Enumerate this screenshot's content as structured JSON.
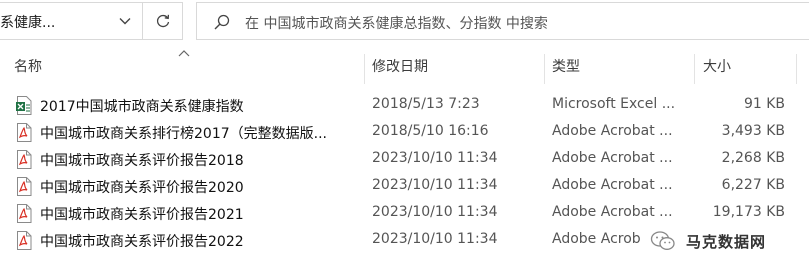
{
  "address_bar": {
    "path": "系健康...",
    "search_placeholder": "在 中国城市政商关系健康总指数、分指数 中搜索"
  },
  "columns": {
    "name": "名称",
    "date": "修改日期",
    "type": "类型",
    "size": "大小"
  },
  "files": [
    {
      "name": "2017中国城市政商关系健康指数",
      "date": "2018/5/13 7:23",
      "type": "Microsoft Excel ...",
      "size": "91 KB",
      "icon": "excel-icon"
    },
    {
      "name": "中国城市政商关系排行榜2017（完整数据版...",
      "date": "2018/5/10 16:16",
      "type": "Adobe Acrobat ...",
      "size": "3,493 KB",
      "icon": "pdf-icon"
    },
    {
      "name": "中国城市政商关系评价报告2018",
      "date": "2023/10/10 11:34",
      "type": "Adobe Acrobat ...",
      "size": "2,268 KB",
      "icon": "pdf-icon"
    },
    {
      "name": "中国城市政商关系评价报告2020",
      "date": "2023/10/10 11:34",
      "type": "Adobe Acrobat ...",
      "size": "6,227 KB",
      "icon": "pdf-icon"
    },
    {
      "name": "中国城市政商关系评价报告2021",
      "date": "2023/10/10 11:34",
      "type": "Adobe Acrobat ...",
      "size": "19,173 KB",
      "icon": "pdf-icon"
    },
    {
      "name": "中国城市政商关系评价报告2022",
      "date": "2023/10/10 11:34",
      "type": "Adobe Acrob",
      "size": "",
      "icon": "pdf-icon"
    }
  ],
  "watermark": {
    "text": "马克数据网",
    "icon": "wechat-icon"
  },
  "colors": {
    "pdf_red": "#d93025",
    "excel_green": "#1f7244",
    "border": "#d9d9d9"
  }
}
